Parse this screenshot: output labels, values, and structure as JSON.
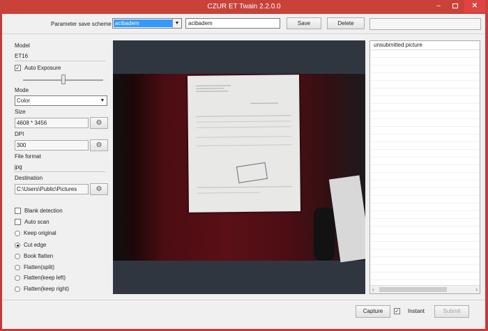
{
  "window": {
    "title": "CZUR ET Twain 2.2.0.0",
    "minimize_glyph": "‒",
    "close_glyph": "✕"
  },
  "toolbar": {
    "scheme_label": "Parameter save scheme",
    "scheme_selected": "acibadem",
    "scheme_name_value": "acibadem",
    "save_label": "Save",
    "delete_label": "Delete",
    "dropdown_glyph": "▼"
  },
  "settings": {
    "model_label": "Model",
    "model_value": "ET16",
    "auto_exposure_label": "Auto Exposure",
    "auto_exposure_checked": true,
    "exposure_level": 0.5,
    "mode_label": "Mode",
    "mode_value": "Color",
    "size_label": "Size",
    "size_value": "4608 * 3456",
    "dpi_label": "DPI",
    "dpi_value": "300",
    "format_label": "File format",
    "format_value": "jpg",
    "destination_label": "Destination",
    "destination_value": "C:\\Users\\Public\\Pictures",
    "gear_glyph": "⚙",
    "check_glyph": "✓"
  },
  "options": {
    "blank_detection": "Blank detection",
    "auto_scan": "Auto scan",
    "radio_options": [
      "Keep original",
      "Cut edge",
      "Book flatten",
      "Flatten(split)",
      "Flatten(keep left)",
      "Flatten(keep right)"
    ],
    "selected_radio": "Cut edge"
  },
  "right_panel": {
    "header": "unsubmitted picture",
    "scroll_left": "‹",
    "scroll_right": "›"
  },
  "bottom": {
    "capture_label": "Capture",
    "instant_label": "Instant",
    "instant_checked": true,
    "submit_label": "Submit"
  },
  "colors": {
    "title_bar": "#c8423a",
    "selection": "#3399ff",
    "preview_background": "#2f3640"
  }
}
